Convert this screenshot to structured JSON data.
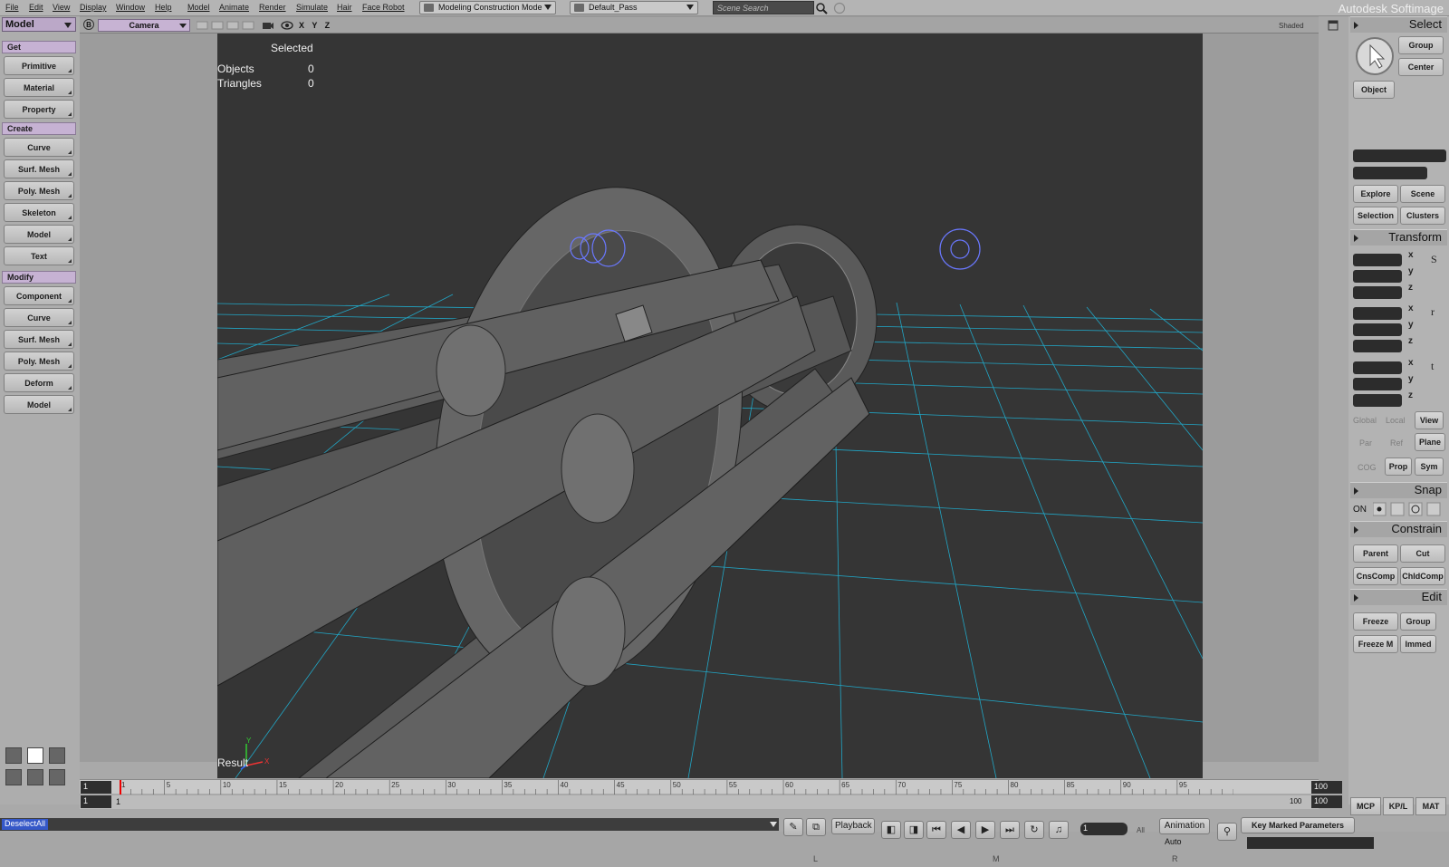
{
  "menubar": {
    "items": [
      "File",
      "Edit",
      "View",
      "Display",
      "Window",
      "Help",
      "Model",
      "Animate",
      "Render",
      "Simulate",
      "Hair",
      "Face Robot"
    ],
    "mode": "Modeling Construction Mode",
    "pass": "Default_Pass",
    "search_placeholder": "Scene Search",
    "brand": "Autodesk Softimage"
  },
  "left": {
    "module": "Model",
    "get_label": "Get",
    "get_items": [
      "Primitive",
      "Material",
      "Property"
    ],
    "create_label": "Create",
    "create_items": [
      "Curve",
      "Surf. Mesh",
      "Poly. Mesh",
      "Skeleton",
      "Model",
      "Text"
    ],
    "modify_label": "Modify",
    "modify_items": [
      "Component",
      "Curve",
      "Surf. Mesh",
      "Poly. Mesh",
      "Deform",
      "Model"
    ]
  },
  "viewport": {
    "letter": "B",
    "camera": "Camera",
    "axes": "X Y Z",
    "shading": "Shaded",
    "selected_label": "Selected",
    "objects_label": "Objects",
    "objects_value": "0",
    "triangles_label": "Triangles",
    "triangles_value": "0",
    "result_label": "Result"
  },
  "timeline": {
    "start": "1",
    "end": "100",
    "ticks": [
      "1",
      "5",
      "10",
      "15",
      "20",
      "25",
      "30",
      "35",
      "40",
      "45",
      "50",
      "55",
      "60",
      "65",
      "70",
      "75",
      "80",
      "85",
      "90",
      "95"
    ],
    "range_start": "1",
    "range_left": "1",
    "range_right": "100",
    "range_end": "100",
    "current_frame": "1"
  },
  "command": {
    "text": "DeselectAll"
  },
  "playback": {
    "playback_label": "Playback",
    "all_label": "All",
    "animation_label": "Animation",
    "auto_label": "Auto",
    "key_marked": "Key Marked Parameters",
    "bottom_letters": [
      "L",
      "M",
      "R"
    ]
  },
  "right": {
    "select_title": "Select",
    "group": "Group",
    "center": "Center",
    "object": "Object",
    "explore": "Explore",
    "scene": "Scene",
    "selection": "Selection",
    "clusters": "Clusters",
    "transform_title": "Transform",
    "axes": [
      "x",
      "y",
      "z",
      "x",
      "y",
      "z",
      "x",
      "y",
      "z"
    ],
    "global": "Global",
    "local": "Local",
    "view": "View",
    "par": "Par",
    "ref": "Ref",
    "plane": "Plane",
    "cog": "COG",
    "prop": "Prop",
    "sym": "Sym",
    "snap_title": "Snap",
    "snap_on": "ON",
    "constrain_title": "Constrain",
    "parent": "Parent",
    "cut": "Cut",
    "cnscomp": "CnsComp",
    "chldcomp": "ChldComp",
    "edit_title": "Edit",
    "freeze": "Freeze",
    "edit_group": "Group",
    "freeze_m": "Freeze M",
    "immed": "Immed",
    "tabs": [
      "MCP",
      "KP/L",
      "MAT"
    ]
  }
}
